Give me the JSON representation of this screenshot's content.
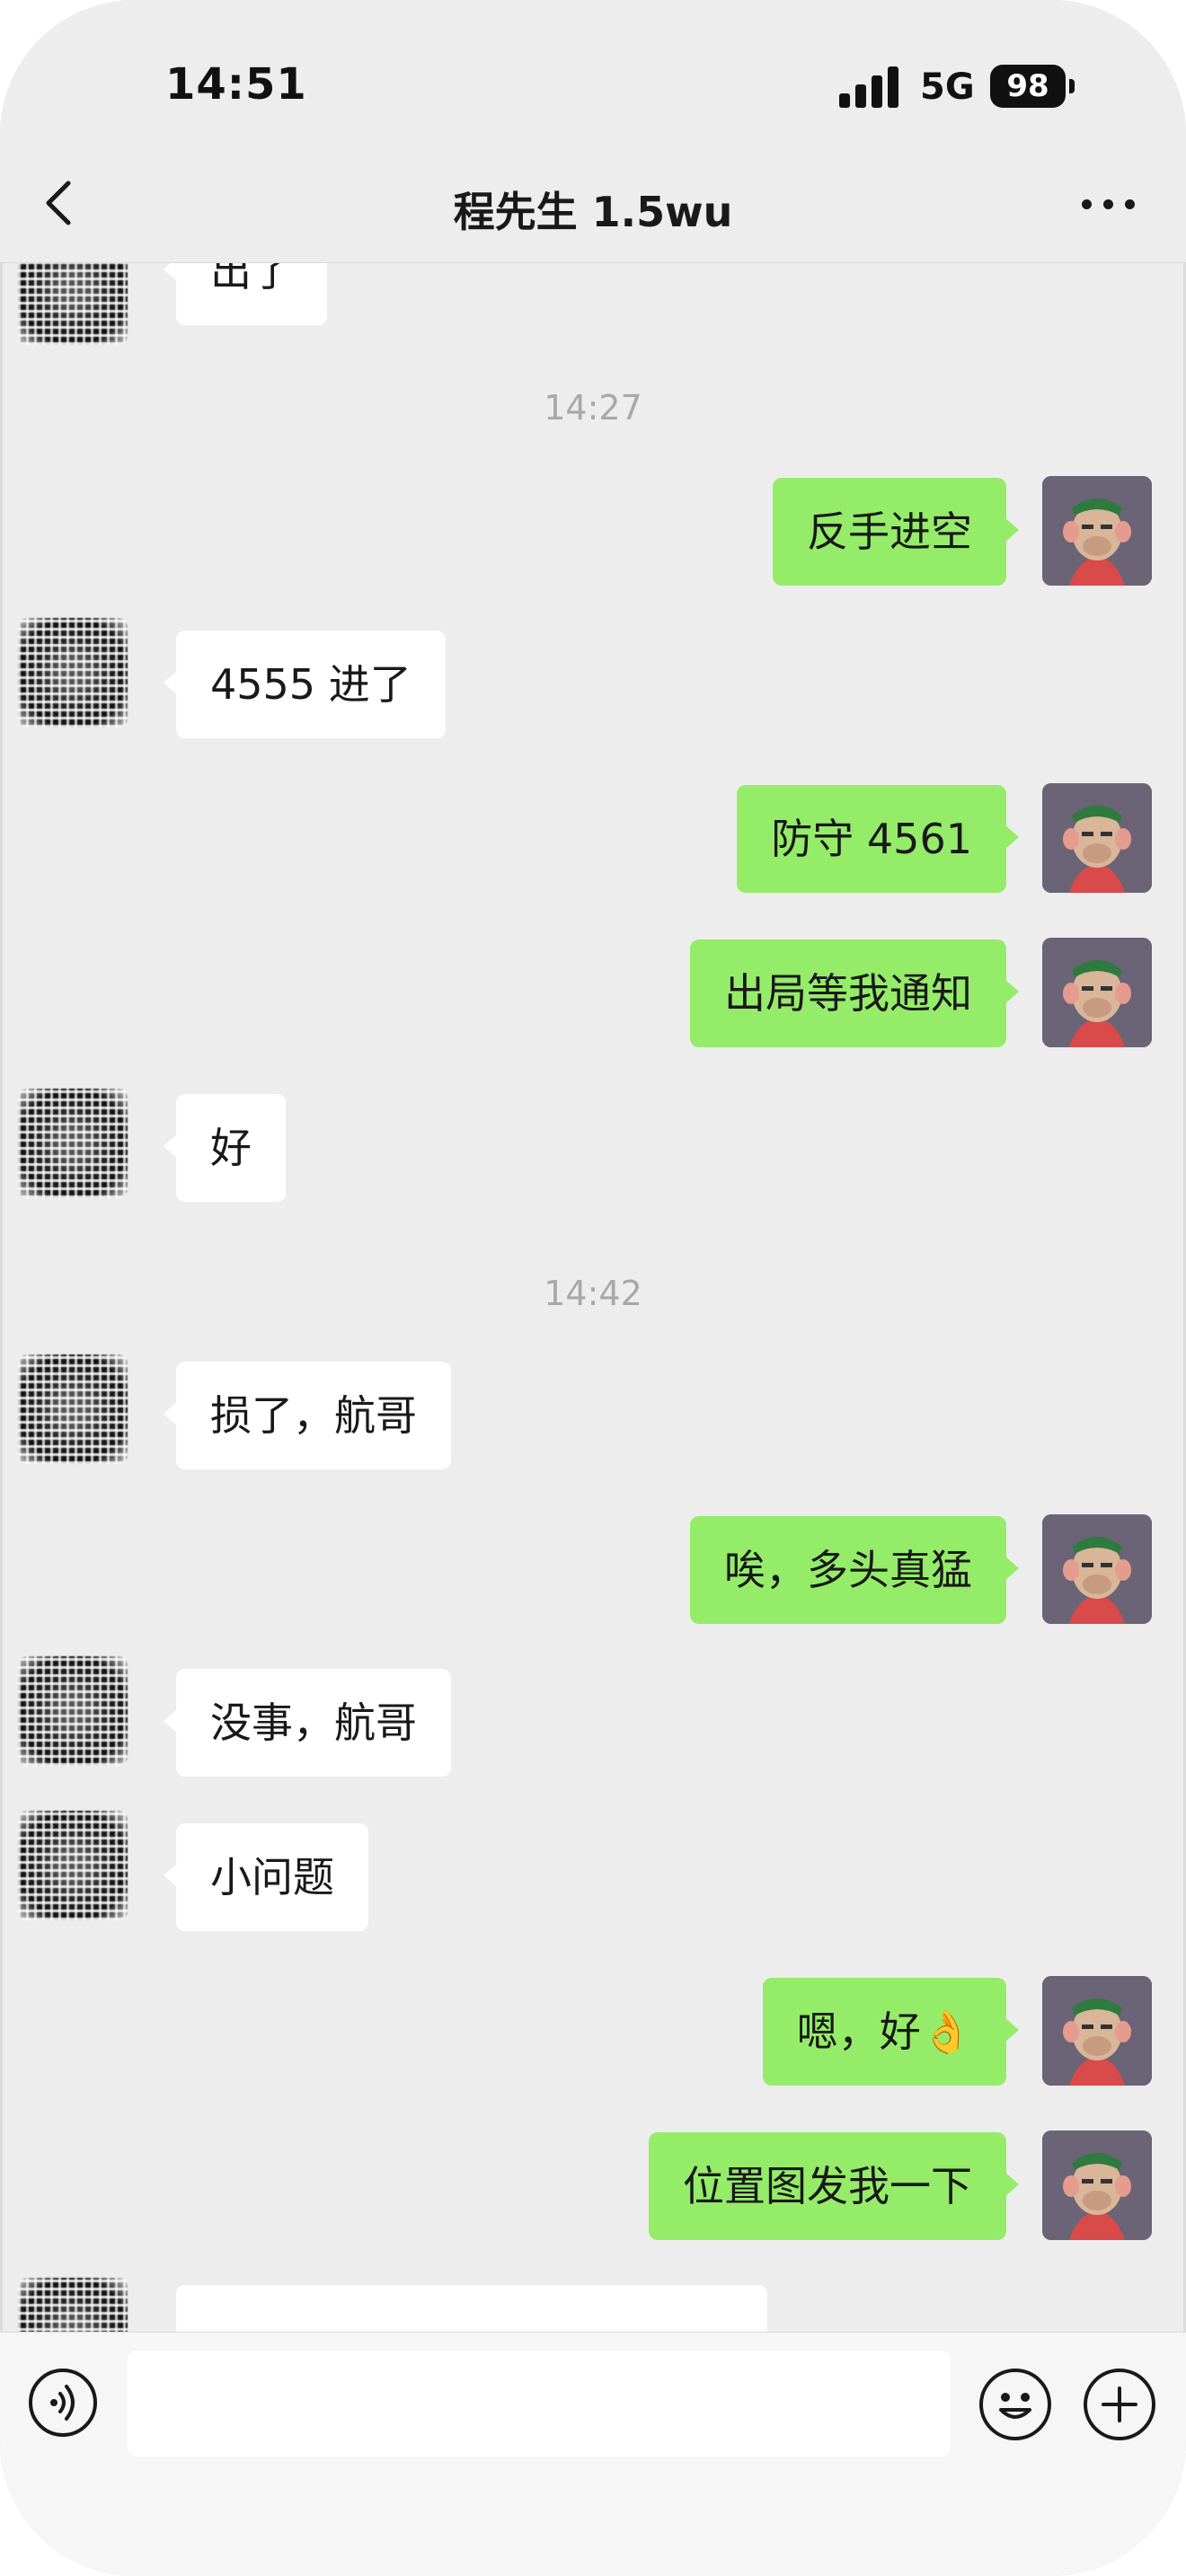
{
  "status_bar": {
    "time": "14:51",
    "network": "5G",
    "battery": "98"
  },
  "header": {
    "title": "程先生 1.5wu"
  },
  "messages": {
    "partial_top": "出了",
    "ts1": "14:27",
    "m1": "反手进空",
    "m2": "4555 进了",
    "m3": "防守 4561",
    "m4": "出局等我通知",
    "m5": "好",
    "ts2": "14:42",
    "m6": "损了，航哥",
    "m7": "唉，多头真猛",
    "m8": "没事，航哥",
    "m9": "小问题",
    "m10": "嗯，好👌",
    "m11": "位置图发我一下"
  },
  "input": {
    "value": ""
  },
  "icons": {
    "back": "chevron-left-icon",
    "more": "more-dots-icon",
    "voice": "voice-icon",
    "emoji": "emoji-icon",
    "plus": "plus-icon"
  },
  "colors": {
    "background": "#ededed",
    "outgoing_bubble": "#95ec69",
    "incoming_bubble": "#ffffff"
  }
}
